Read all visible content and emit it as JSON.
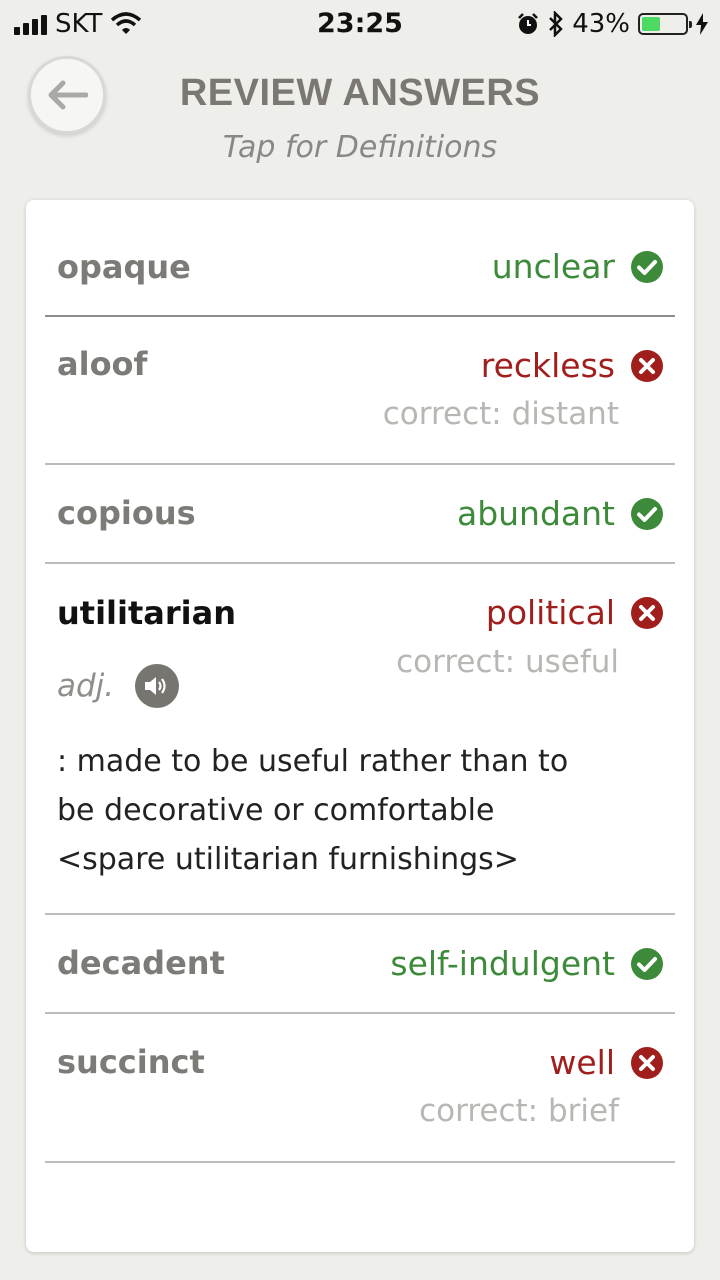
{
  "status_bar": {
    "carrier": "SKT",
    "time": "23:25",
    "battery": "43%"
  },
  "header": {
    "title": "REVIEW ANSWERS",
    "subtitle": "Tap for Definitions"
  },
  "colors": {
    "correct": "#3d8b3a",
    "incorrect": "#a01f1d",
    "muted": "#b8b7b3"
  },
  "answers": [
    {
      "word": "opaque",
      "answer": "unclear",
      "status": "correct",
      "icon": "check-circle-icon"
    },
    {
      "word": "aloof",
      "answer": "reckless",
      "status": "incorrect",
      "icon": "x-circle-icon",
      "correct_text": "correct: distant"
    },
    {
      "word": "copious",
      "answer": "abundant",
      "status": "correct",
      "icon": "check-circle-icon"
    },
    {
      "word": "utilitarian",
      "answer": "political",
      "status": "incorrect",
      "icon": "x-circle-icon",
      "correct_text": "correct: useful",
      "part_of_speech": "adj.",
      "definition_lines": [
        ": made to be useful rather than to",
        "be decorative or comfortable",
        "<spare utilitarian furnishings>"
      ]
    },
    {
      "word": "decadent",
      "answer": "self-indulgent",
      "status": "correct",
      "icon": "check-circle-icon"
    },
    {
      "word": "succinct",
      "answer": "well",
      "status": "incorrect",
      "icon": "x-circle-icon",
      "correct_text": "correct: brief"
    }
  ]
}
